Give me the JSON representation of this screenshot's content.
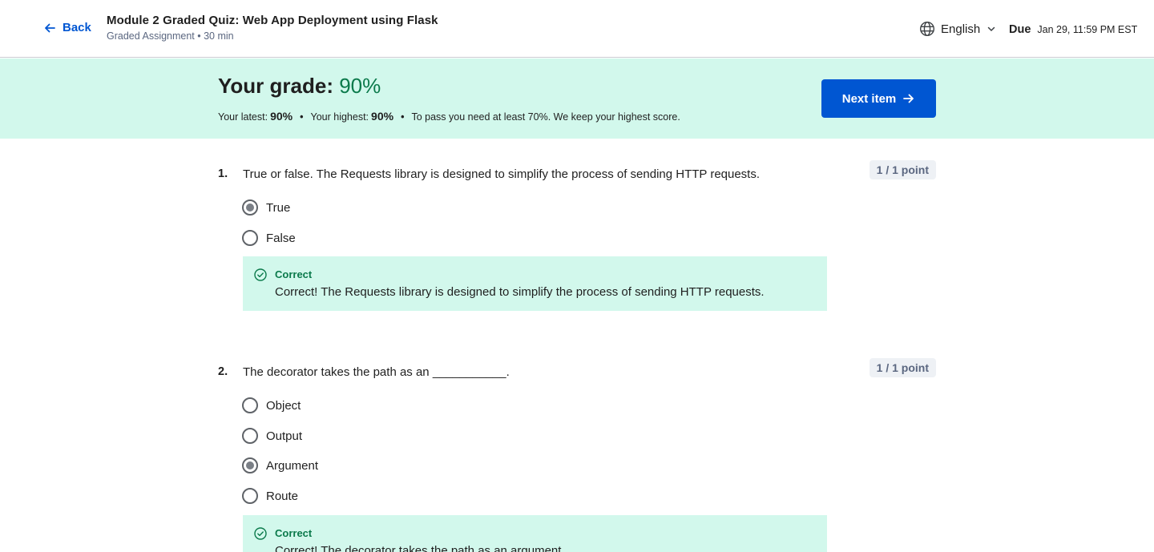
{
  "header": {
    "back_label": "Back",
    "title": "Module 2 Graded Quiz: Web App Deployment using Flask",
    "subtitle": "Graded Assignment • 30 min",
    "language": "English",
    "due_label": "Due",
    "due_date": "Jan 29, 11:59 PM EST"
  },
  "banner": {
    "grade_prefix": "Your grade:",
    "grade_value": "90%",
    "latest_label": "Your latest:",
    "latest_value": "90%",
    "highest_label": "Your highest:",
    "highest_value": "90%",
    "pass_note": "To pass you need at least 70%. We keep your highest score.",
    "next_label": "Next item"
  },
  "questions": [
    {
      "number": "1.",
      "text": "True or false. The Requests library is designed to simplify the process of sending HTTP requests.",
      "points": "1 / 1 point",
      "options": [
        "True",
        "False"
      ],
      "selected": 0,
      "feedback_head": "Correct",
      "feedback_text": "Correct! The Requests library is designed to simplify the process of sending HTTP requests."
    },
    {
      "number": "2.",
      "text": "The decorator takes the path as an ___________.",
      "points": "1 / 1 point",
      "options": [
        "Object",
        "Output",
        "Argument",
        "Route"
      ],
      "selected": 2,
      "feedback_head": "Correct",
      "feedback_text": "Correct! The decorator takes the path as an argument."
    }
  ],
  "colors": {
    "accent": "#0056d2",
    "success_bg": "#d2f8ec",
    "success_text": "#0b7a4b"
  },
  "icons": [
    "arrow-left-icon",
    "globe-icon",
    "chevron-down-icon",
    "arrow-right-icon",
    "check-circle-icon"
  ]
}
